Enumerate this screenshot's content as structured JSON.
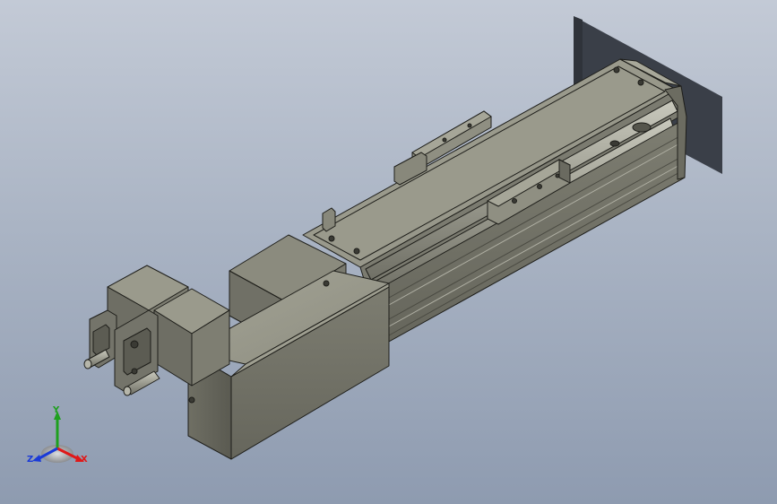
{
  "viewport": {
    "background_top": "#c3cad6",
    "background_bottom": "#8e9bb0",
    "model_color": "#8a8a7c",
    "edge_color": "#1e1e1a"
  },
  "triad": {
    "x_label": "X",
    "y_label": "Y",
    "z_label": "Z",
    "x_color": "#e01818",
    "y_color": "#1ea01e",
    "z_color": "#1a3ad8"
  }
}
